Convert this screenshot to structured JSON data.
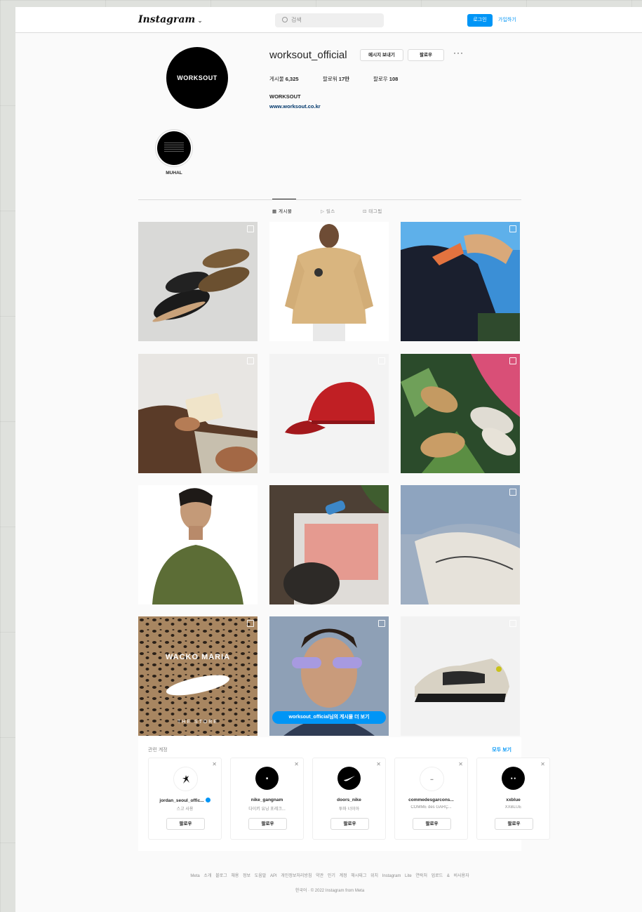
{
  "topbar": {
    "logo": "Instagram",
    "search_placeholder": "검색",
    "login": "로그인",
    "signup": "가입하기"
  },
  "profile": {
    "avatar_text": "WORKSOUT",
    "username": "worksout_official",
    "message_button": "메시지 보내기",
    "follow_button": "팔로우",
    "stats": [
      {
        "label": "게시물",
        "value": "6,325"
      },
      {
        "label": "팔로워",
        "value": "17만"
      },
      {
        "label": "팔로우",
        "value": "108"
      }
    ],
    "bio_name": "WORKSOUT",
    "bio_link": "www.worksout.co.kr"
  },
  "highlights": [
    {
      "label": "MUHAL"
    }
  ],
  "tabs": [
    "게시물",
    "릴스",
    "태그됨"
  ],
  "posts": {
    "cta": "worksout_official님의 게시물 더 보기",
    "wacko_title": "WACKO MARIA",
    "wacko_footer": "THE STORE"
  },
  "related": {
    "title": "관련 계정",
    "see_all": "모두 보기",
    "accounts": [
      {
        "name": "jordan_seoul_offic...",
        "sub": "스고 사용",
        "button": "팔로우",
        "verified": true
      },
      {
        "name": "nike_gangnam",
        "sub": "다이키 유닝 포레크...",
        "button": "팔로우",
        "verified": false
      },
      {
        "name": "doors_nike",
        "sub": "투마 너이아",
        "button": "팔로우",
        "verified": false
      },
      {
        "name": "commedesgarcons...",
        "sub": "COMME des GARÇ...",
        "button": "팔로우",
        "verified": false
      },
      {
        "name": "xxblue",
        "sub": "XXBLUE",
        "button": "팔로우",
        "verified": false
      }
    ]
  },
  "footer": {
    "links": "Meta 소개 블로그 채용 정보 도움말 API 개인정보처리방침 약관 인기 계정 해시태그 위치 Instagram Lite 연락처 업로드 & 비사용자",
    "copyright": "한국어 · © 2022 Instagram from Meta"
  }
}
